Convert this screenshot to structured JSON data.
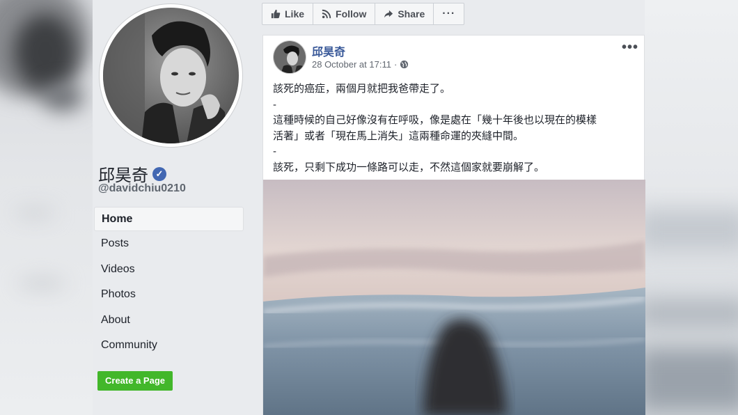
{
  "page": {
    "name": "邱昊奇",
    "handle": "@davidchiu0210"
  },
  "nav": {
    "items": [
      {
        "label": "Home"
      },
      {
        "label": "Posts"
      },
      {
        "label": "Videos"
      },
      {
        "label": "Photos"
      },
      {
        "label": "About"
      },
      {
        "label": "Community"
      }
    ],
    "create_page_label": "Create a Page"
  },
  "actions": {
    "like": "Like",
    "follow": "Follow",
    "share": "Share",
    "more": "···"
  },
  "post": {
    "author": "邱昊奇",
    "timestamp": "28 October at 17:11",
    "separator": "·",
    "menu": "•••",
    "lines": [
      "該死的癌症，兩個月就把我爸帶走了。",
      "-",
      "這種時候的自己好像沒有在呼吸，像是處在「幾十年後也以現在的模樣",
      "活著」或者「現在馬上消失」這兩種命運的夾縫中間。",
      "-",
      "該死，只剩下成功一條路可以走，不然這個家就要崩解了。"
    ]
  },
  "colors": {
    "link": "#385898",
    "green": "#42b72a",
    "verified": "#4267b2"
  }
}
